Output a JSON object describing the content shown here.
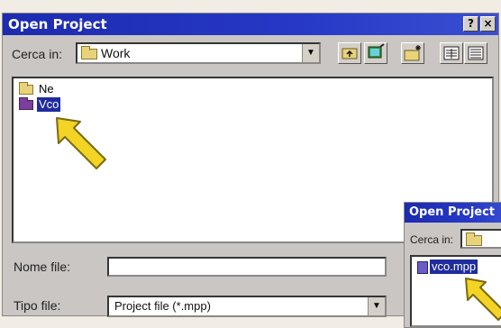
{
  "main_dialog": {
    "title": "Open Project",
    "help_button": "?",
    "close_button": "×",
    "look_in_label": "Cerca in:",
    "look_in_value": "Work",
    "files": [
      {
        "name": "Ne",
        "selected": false
      },
      {
        "name": "Vco",
        "selected": true
      }
    ],
    "filename_label": "Nome file:",
    "filename_value": "",
    "filetype_label": "Tipo file:",
    "filetype_value": "Project file (*.mpp)"
  },
  "secondary_dialog": {
    "title": "Open Project",
    "look_in_label": "Cerca in:",
    "files": [
      {
        "name": "vco.mpp",
        "selected": true
      }
    ]
  },
  "colors": {
    "title_bar": "#1d2bb0",
    "selection": "#1f2c9e",
    "arrow_fill": "#f3d324",
    "arrow_stroke": "#7a6a10"
  },
  "icons": [
    "folder-icon",
    "up-folder-icon",
    "desktop-icon",
    "new-folder-icon",
    "list-view-icon",
    "details-view-icon",
    "file-icon",
    "arrow-pointer-icon",
    "help-icon",
    "close-icon",
    "dropdown-arrow-icon"
  ]
}
